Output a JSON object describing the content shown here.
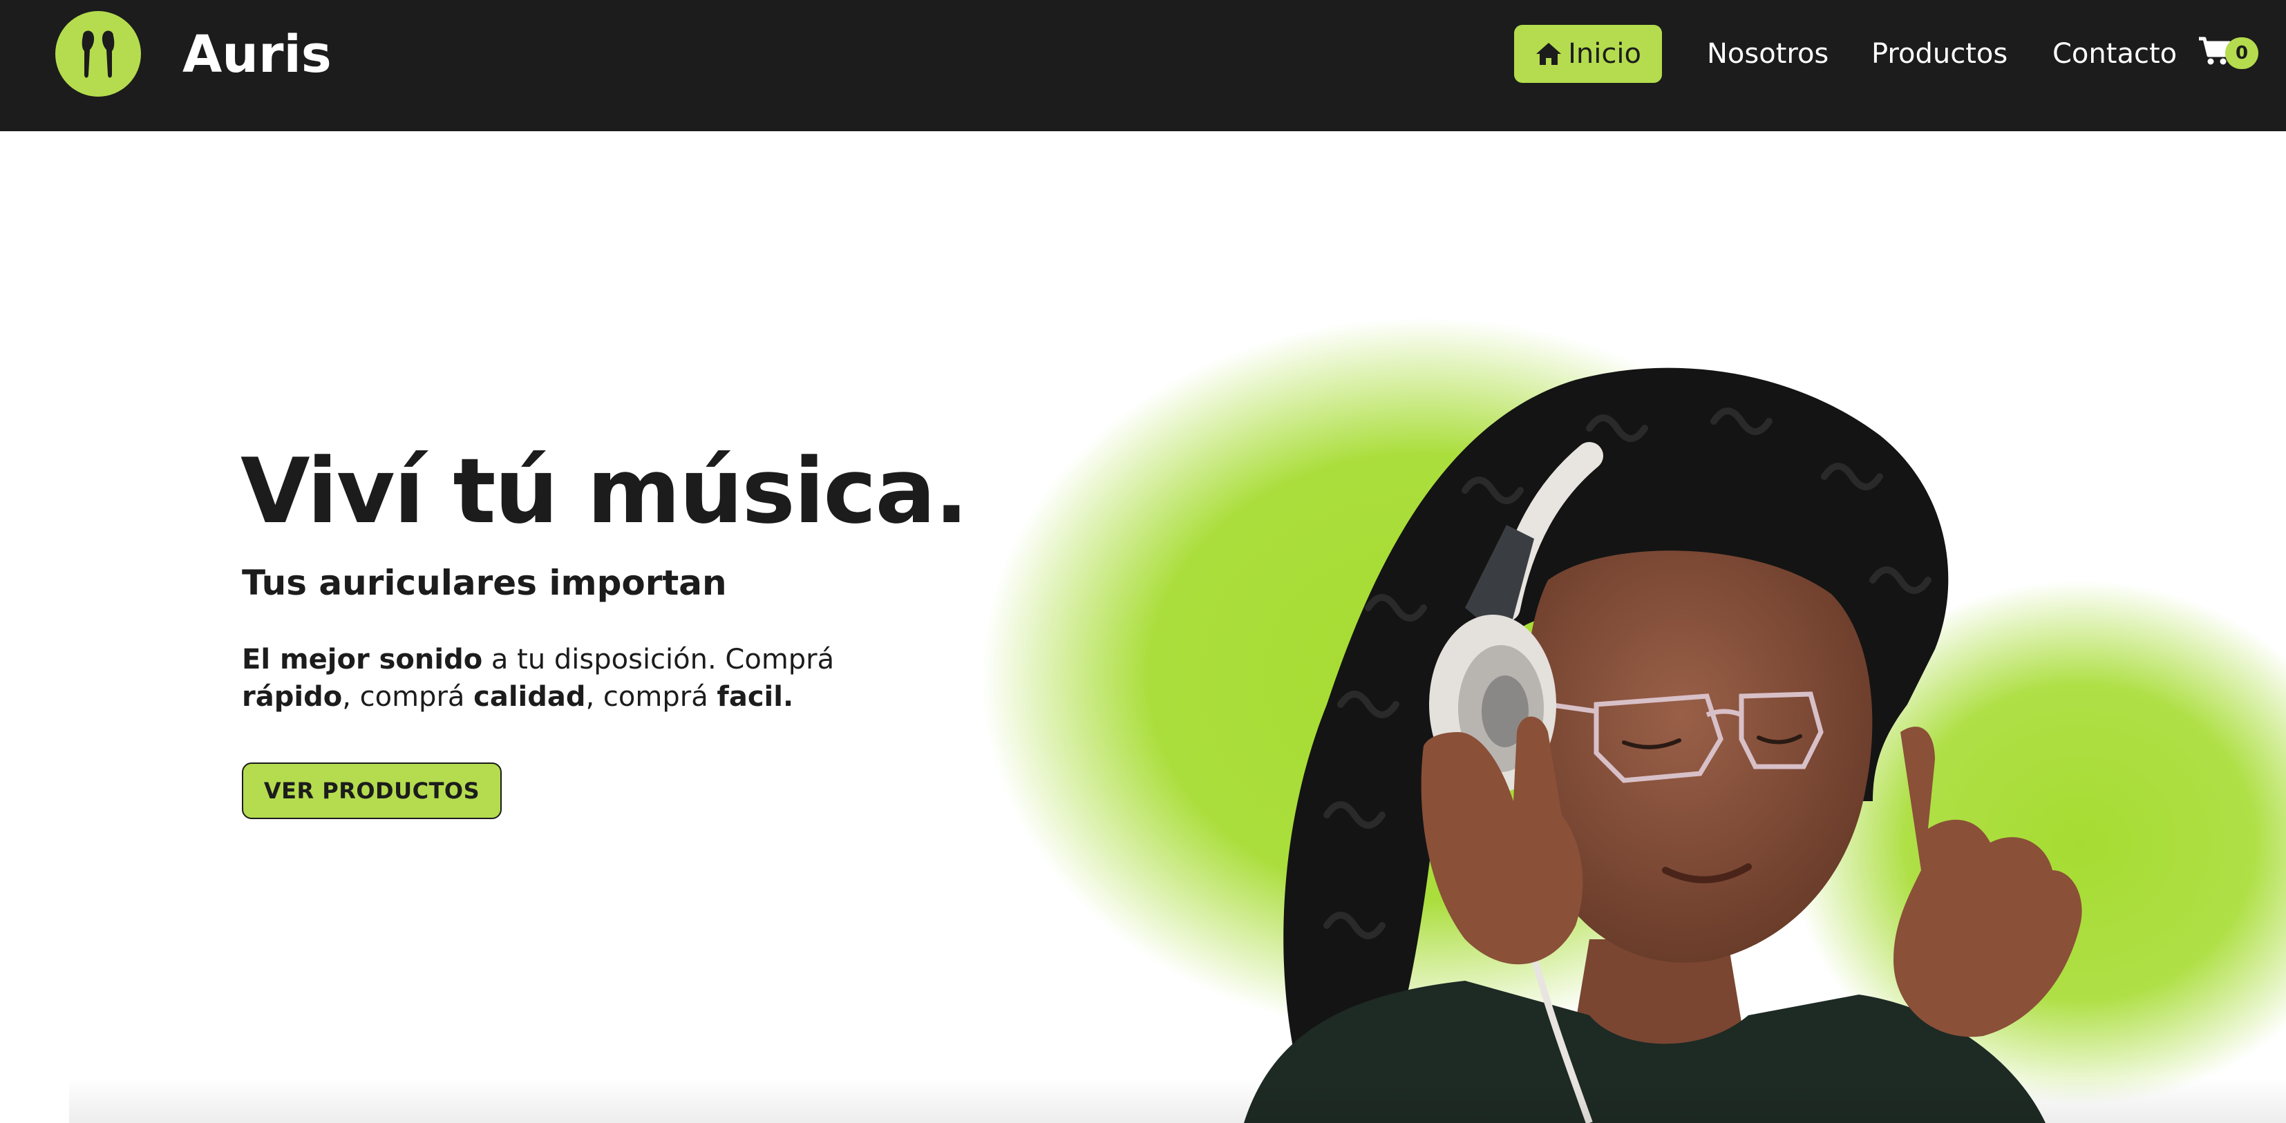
{
  "header": {
    "brand": "Auris",
    "logo_icon": "earbuds-icon",
    "nav": {
      "home": "Inicio",
      "home_icon": "house-icon",
      "about": "Nosotros",
      "products": "Productos",
      "contact": "Contacto"
    },
    "cart_icon": "shopping-cart-icon",
    "cart_count": "0"
  },
  "hero": {
    "title": "Viví tú música.",
    "subtitle": "Tus auriculares importan",
    "description": {
      "part1_bold": "El mejor sonido",
      "part2": " a tu disposición. Comprá ",
      "part3_bold": "rápido",
      "part4": ", comprá ",
      "part5_bold": "calidad",
      "part6": ", comprá ",
      "part7_bold": "facil."
    },
    "cta_label": "VER PRODUCTOS"
  },
  "colors": {
    "accent": "#b4dc4e",
    "navbar_bg": "#1c1c1c",
    "text": "#1c1c1c",
    "background": "#ffffff"
  }
}
